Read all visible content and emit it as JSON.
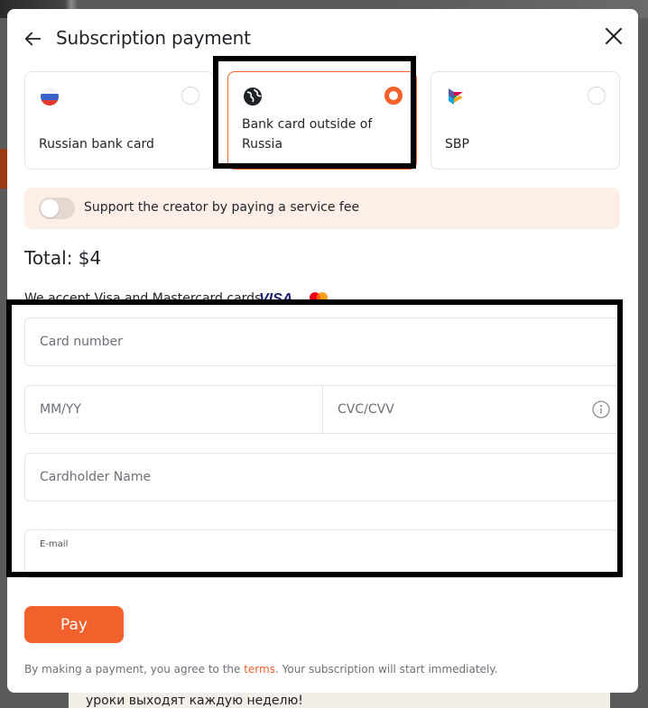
{
  "background": {
    "bottom_text": "уроки выходят каждую неделю!"
  },
  "modal": {
    "title": "Subscription payment",
    "back_icon": "arrow-left-icon",
    "close_icon": "close-x-icon"
  },
  "payment_methods": [
    {
      "label": "Russian bank card",
      "icon": "russia-flag-icon",
      "selected": false
    },
    {
      "label": "Bank card outside of Russia",
      "icon": "globe-icon",
      "selected": true
    },
    {
      "label": "SBP",
      "icon": "sbp-logo-icon",
      "selected": false
    }
  ],
  "fee": {
    "label": "Support the creator by paying a service fee",
    "enabled": false
  },
  "total": "Total: $4",
  "accept": {
    "text": "We accept Visa and Mastercard cards",
    "visa_text": "VISA"
  },
  "form": {
    "card_number_placeholder": "Card number",
    "expiry_placeholder": "MM/YY",
    "cvc_placeholder": "CVC/CVV",
    "cardholder_placeholder": "Cardholder Name",
    "email_label": "E-mail",
    "email_value": ""
  },
  "pay_button": "Pay",
  "footer": {
    "prefix": "By making a payment, you agree to the ",
    "link": "terms",
    "suffix": ". Your subscription will start immediately."
  },
  "colors": {
    "accent": "#f2602c",
    "fee_bg": "#fdefe8",
    "visa_blue": "#1a1f71"
  }
}
